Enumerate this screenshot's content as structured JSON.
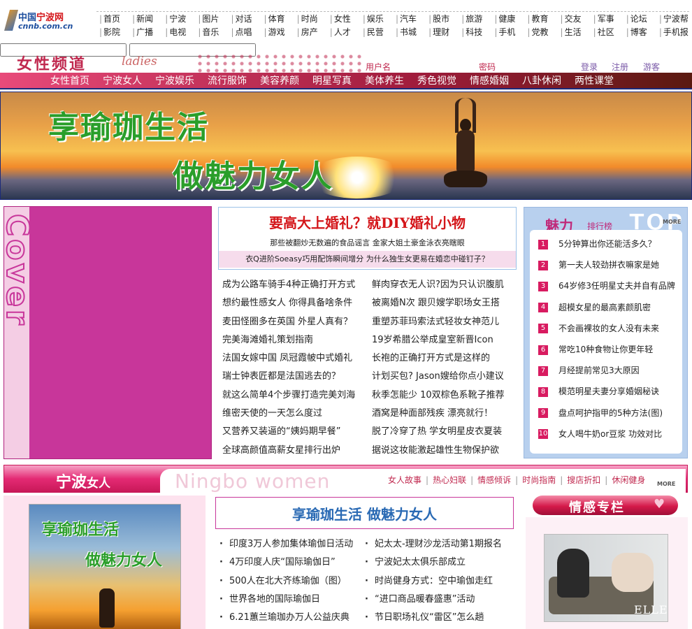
{
  "logo": {
    "part1": "中国",
    "part2": "宁波网",
    "domain": "cnnb.com.cn"
  },
  "topnav": {
    "row1": [
      "首页",
      "新闻",
      "宁波",
      "图片",
      "对话",
      "体育",
      "时尚",
      "女性",
      "娱乐",
      "汽车",
      "股市",
      "旅游",
      "健康",
      "教育",
      "交友",
      "军事",
      "论坛",
      "宁波帮"
    ],
    "row2": [
      "影院",
      "广播",
      "电视",
      "音乐",
      "点唱",
      "游戏",
      "房产",
      "人才",
      "民营",
      "书城",
      "理财",
      "科技",
      "手机",
      "党教",
      "生活",
      "社区",
      "博客",
      "手机报"
    ]
  },
  "channel": {
    "title": "女性频道",
    "subtitle": "ladies"
  },
  "login": {
    "username_label": "用户名",
    "password_label": "密码",
    "login": "登录",
    "register": "注册",
    "guest": "游客"
  },
  "subnav": [
    "女性首页",
    "宁波女人",
    "宁波娱乐",
    "流行服饰",
    "美容养颜",
    "明星写真",
    "美体养生",
    "秀色视觉",
    "情感婚姻",
    "八卦休闲",
    "两性课堂"
  ],
  "banner": {
    "line1": "享瑜珈生活",
    "line2": "做魅力女人"
  },
  "cover": {
    "word": "Cover"
  },
  "headline": {
    "title": "要高大上婚礼？就DIY婚礼小物",
    "sub1": "那些被翻炒无数遍的食品谣言 金家大姐土豪金泳衣亮瞎眼",
    "sub2": "衣Q进阶Soeasy巧用配饰瞬间增分 为什么独生女更易在婚恋中碰钉子？"
  },
  "news_left": [
    "成为公路车骑手4种正确打开方式",
    "想约最性感女人 你得具备啥条件",
    "麦田怪圈多在英国 外星人真有？",
    "完美海滩婚礼策划指南",
    "法国女嫁中国 凤冠霞帔中式婚礼",
    "瑞士钟表匠都是法国逃去的？",
    "就这么简单4个步骤打造完美刘海",
    "维密天使的一天怎么度过",
    "又营养又装逼的“姨妈期早餐”",
    "全球高颜值高薪女星排行出炉"
  ],
  "news_right": [
    "鲜肉穿衣无人识?因为只认识腹肌",
    "被离婚N次 跟贝嫂学职场女王搭",
    "重塑苏菲玛索法式轻妆女神范儿",
    "19岁希腊公举成皇室新晋Icon",
    "长袍的正确打开方式是这样的",
    "计划买包? Jason嫂给你点小建议",
    "秋季怎能少 10双棕色系靴子推荐",
    "酒窝是种面部残疾 漂亮就行！",
    "脱了冷穿了热 学女明星皮衣夏装",
    "据说这妆能激起雄性生物保护欲"
  ],
  "ranking": {
    "title": "魅力",
    "subtitle": "排行榜",
    "top": "TOP",
    "more": "MORE",
    "items": [
      {
        "num": "1",
        "text": "5分钟算出你还能活多久？"
      },
      {
        "num": "2",
        "text": "第一夫人较劲拼衣嘛家是她"
      },
      {
        "num": "3",
        "text": "64岁修3任明星丈夫并自有品牌"
      },
      {
        "num": "4",
        "text": "超模女星的最高素颜肌密"
      },
      {
        "num": "5",
        "text": "不会画裸妆的女人没有未来"
      },
      {
        "num": "6",
        "text": "常吃10种食物让你更年轻"
      },
      {
        "num": "7",
        "text": "月经提前常见3大原因"
      },
      {
        "num": "8",
        "text": "模范明星夫妻分享婚姻秘诀"
      },
      {
        "num": "9",
        "text": "盘点呵护指甲的5种方法(图)"
      },
      {
        "num": "10",
        "text": "女人喝牛奶or豆浆 功效对比"
      }
    ]
  },
  "ningbo": {
    "title": "宁波",
    "title2": "女人",
    "en": "Ningbo women",
    "links": [
      "女人故事",
      "热心妇联",
      "情感倾诉",
      "时尚指南",
      "搜店折扣",
      "休闲健身"
    ],
    "more": "MORE",
    "pic_line1": "享瑜珈生活",
    "pic_line2": "做魅力女人",
    "headline": "享瑜珈生活 做魅力女人",
    "list_left": [
      "印度3万人参加集体瑜伽日活动",
      "4万印度人庆“国际瑜伽日”",
      "500人在北大齐练瑜伽（图）",
      "世界各地的国际瑜伽日",
      "6.21蕙兰瑜珈办万人公益庆典"
    ],
    "list_right": [
      "妃太太-理财沙龙活动第1期报名",
      "宁波妃太太俱乐部成立",
      "时尚健身方式：空中瑜伽走红",
      "“进口商品暖春盛惠”活动",
      "节日职场礼仪“雷区”怎么趟"
    ]
  },
  "emotion": {
    "title": "情感专栏",
    "brand": "ELLE"
  }
}
